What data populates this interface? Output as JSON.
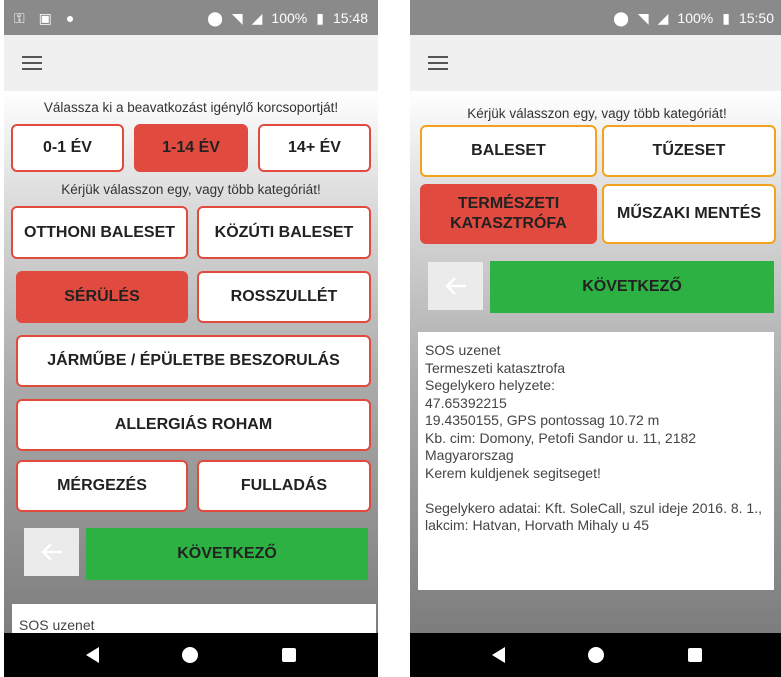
{
  "left_screen": {
    "status": {
      "battery": "100%",
      "time": "15:48"
    },
    "age_prompt": "Válassza ki a beavatkozást igénylő korcsoportját!",
    "age_buttons": [
      {
        "label": "0-1 ÉV",
        "selected": false
      },
      {
        "label": "1-14 ÉV",
        "selected": true
      },
      {
        "label": "14+ ÉV",
        "selected": false
      }
    ],
    "category_prompt": "Kérjük válasszon egy, vagy több kategóriát!",
    "categories": [
      {
        "label": "OTTHONI BALESET",
        "selected": false
      },
      {
        "label": "KÖZÚTI BALESET",
        "selected": false
      },
      {
        "label": "SÉRÜLÉS",
        "selected": true
      },
      {
        "label": "ROSSZULLÉT",
        "selected": false
      },
      {
        "label": "JÁRMŰBE / ÉPÜLETBE BESZORULÁS",
        "selected": false
      },
      {
        "label": "ALLERGIÁS ROHAM",
        "selected": false
      },
      {
        "label": "MÉRGEZÉS",
        "selected": false
      },
      {
        "label": "FULLADÁS",
        "selected": false
      }
    ],
    "next_label": "KÖVETKEZŐ",
    "message_preview": "SOS uzenet"
  },
  "right_screen": {
    "status": {
      "battery": "100%",
      "time": "15:50"
    },
    "category_prompt": "Kérjük válasszon egy, vagy több kategóriát!",
    "categories": [
      {
        "label": "BALESET",
        "selected": false
      },
      {
        "label": "TŰZESET",
        "selected": false
      },
      {
        "label": "TERMÉSZETI KATASZTRÓFA",
        "selected": true
      },
      {
        "label": "MŰSZAKI MENTÉS",
        "selected": false
      }
    ],
    "next_label": "KÖVETKEZŐ",
    "message": "SOS uzenet\nTermeszeti katasztrofa\nSegelykero helyzete:\n47.65392215\n19.4350155, GPS pontossag 10.72 m\nKb. cim: Domony, Petofi Sandor u. 11, 2182 Magyarorszag\nKerem kuldjenek segitseget!\n\nSegelykero adatai: Kft. SoleCall, szul ideje 2016. 8. 1., lakcim: Hatvan, Horvath Mihaly u 45"
  },
  "colors": {
    "selected": "#e14a3e",
    "next": "#2db142",
    "border_red": "#e14a3e",
    "border_orange": "#f2a21c"
  },
  "icons": [
    "key-icon",
    "battery-saver-icon",
    "circle-icon",
    "location-icon",
    "wifi-icon",
    "signal-icon",
    "battery-icon",
    "menu-icon",
    "arrow-left-icon",
    "nav-back-icon",
    "nav-home-icon",
    "nav-recent-icon"
  ]
}
